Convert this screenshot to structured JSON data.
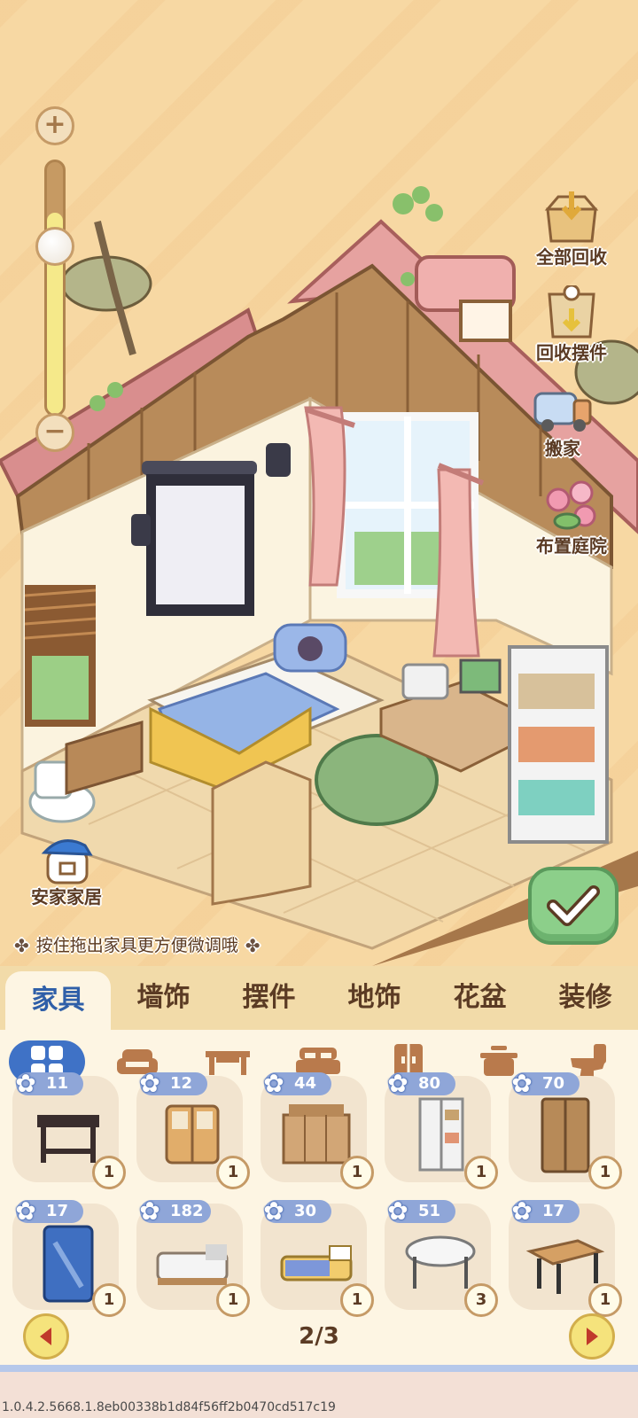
{
  "side_actions": [
    {
      "label": "全部回收",
      "icon": "box-recycle-all-icon"
    },
    {
      "label": "回收摆件",
      "icon": "cup-recycle-icon"
    },
    {
      "label": "搬家",
      "icon": "moving-truck-icon"
    },
    {
      "label": "布置庭院",
      "icon": "garden-flowers-icon"
    }
  ],
  "brand_label": "安家家居",
  "hint_text": "按住拖出家具更方便微调哦",
  "zoom": {
    "plus": "+",
    "minus": "−",
    "level": 0.8
  },
  "tabs": [
    "家具",
    "墙饰",
    "摆件",
    "地饰",
    "花盆",
    "装修"
  ],
  "active_tab": 0,
  "categories": [
    "all-grid-icon",
    "sofa-icon",
    "table-icon",
    "bed-icon",
    "wardrobe-icon",
    "stove-icon",
    "toilet-icon"
  ],
  "items": [
    {
      "count": "11",
      "qty": "1",
      "icon": "side-table-icon"
    },
    {
      "count": "12",
      "qty": "1",
      "icon": "cabinet-icon"
    },
    {
      "count": "44",
      "qty": "1",
      "icon": "sideboard-icon"
    },
    {
      "count": "80",
      "qty": "1",
      "icon": "shelf-wardrobe-icon"
    },
    {
      "count": "70",
      "qty": "1",
      "icon": "wood-wardrobe-icon"
    },
    {
      "count": "17",
      "qty": "1",
      "icon": "blue-closet-icon"
    },
    {
      "count": "182",
      "qty": "1",
      "icon": "white-bed-icon"
    },
    {
      "count": "30",
      "qty": "1",
      "icon": "yellow-bed-icon"
    },
    {
      "count": "51",
      "qty": "3",
      "icon": "round-table-icon"
    },
    {
      "count": "17",
      "qty": "1",
      "icon": "wood-table-icon"
    }
  ],
  "pager": "2/3",
  "version": "1.0.4.2.5668.1.8eb00338b1d84f56ff2b0470cd517c19",
  "colors": {
    "accent_blue": "#3f72c6",
    "panel_bg": "#fdf5e3",
    "confirm_green": "#8ccf8a"
  }
}
